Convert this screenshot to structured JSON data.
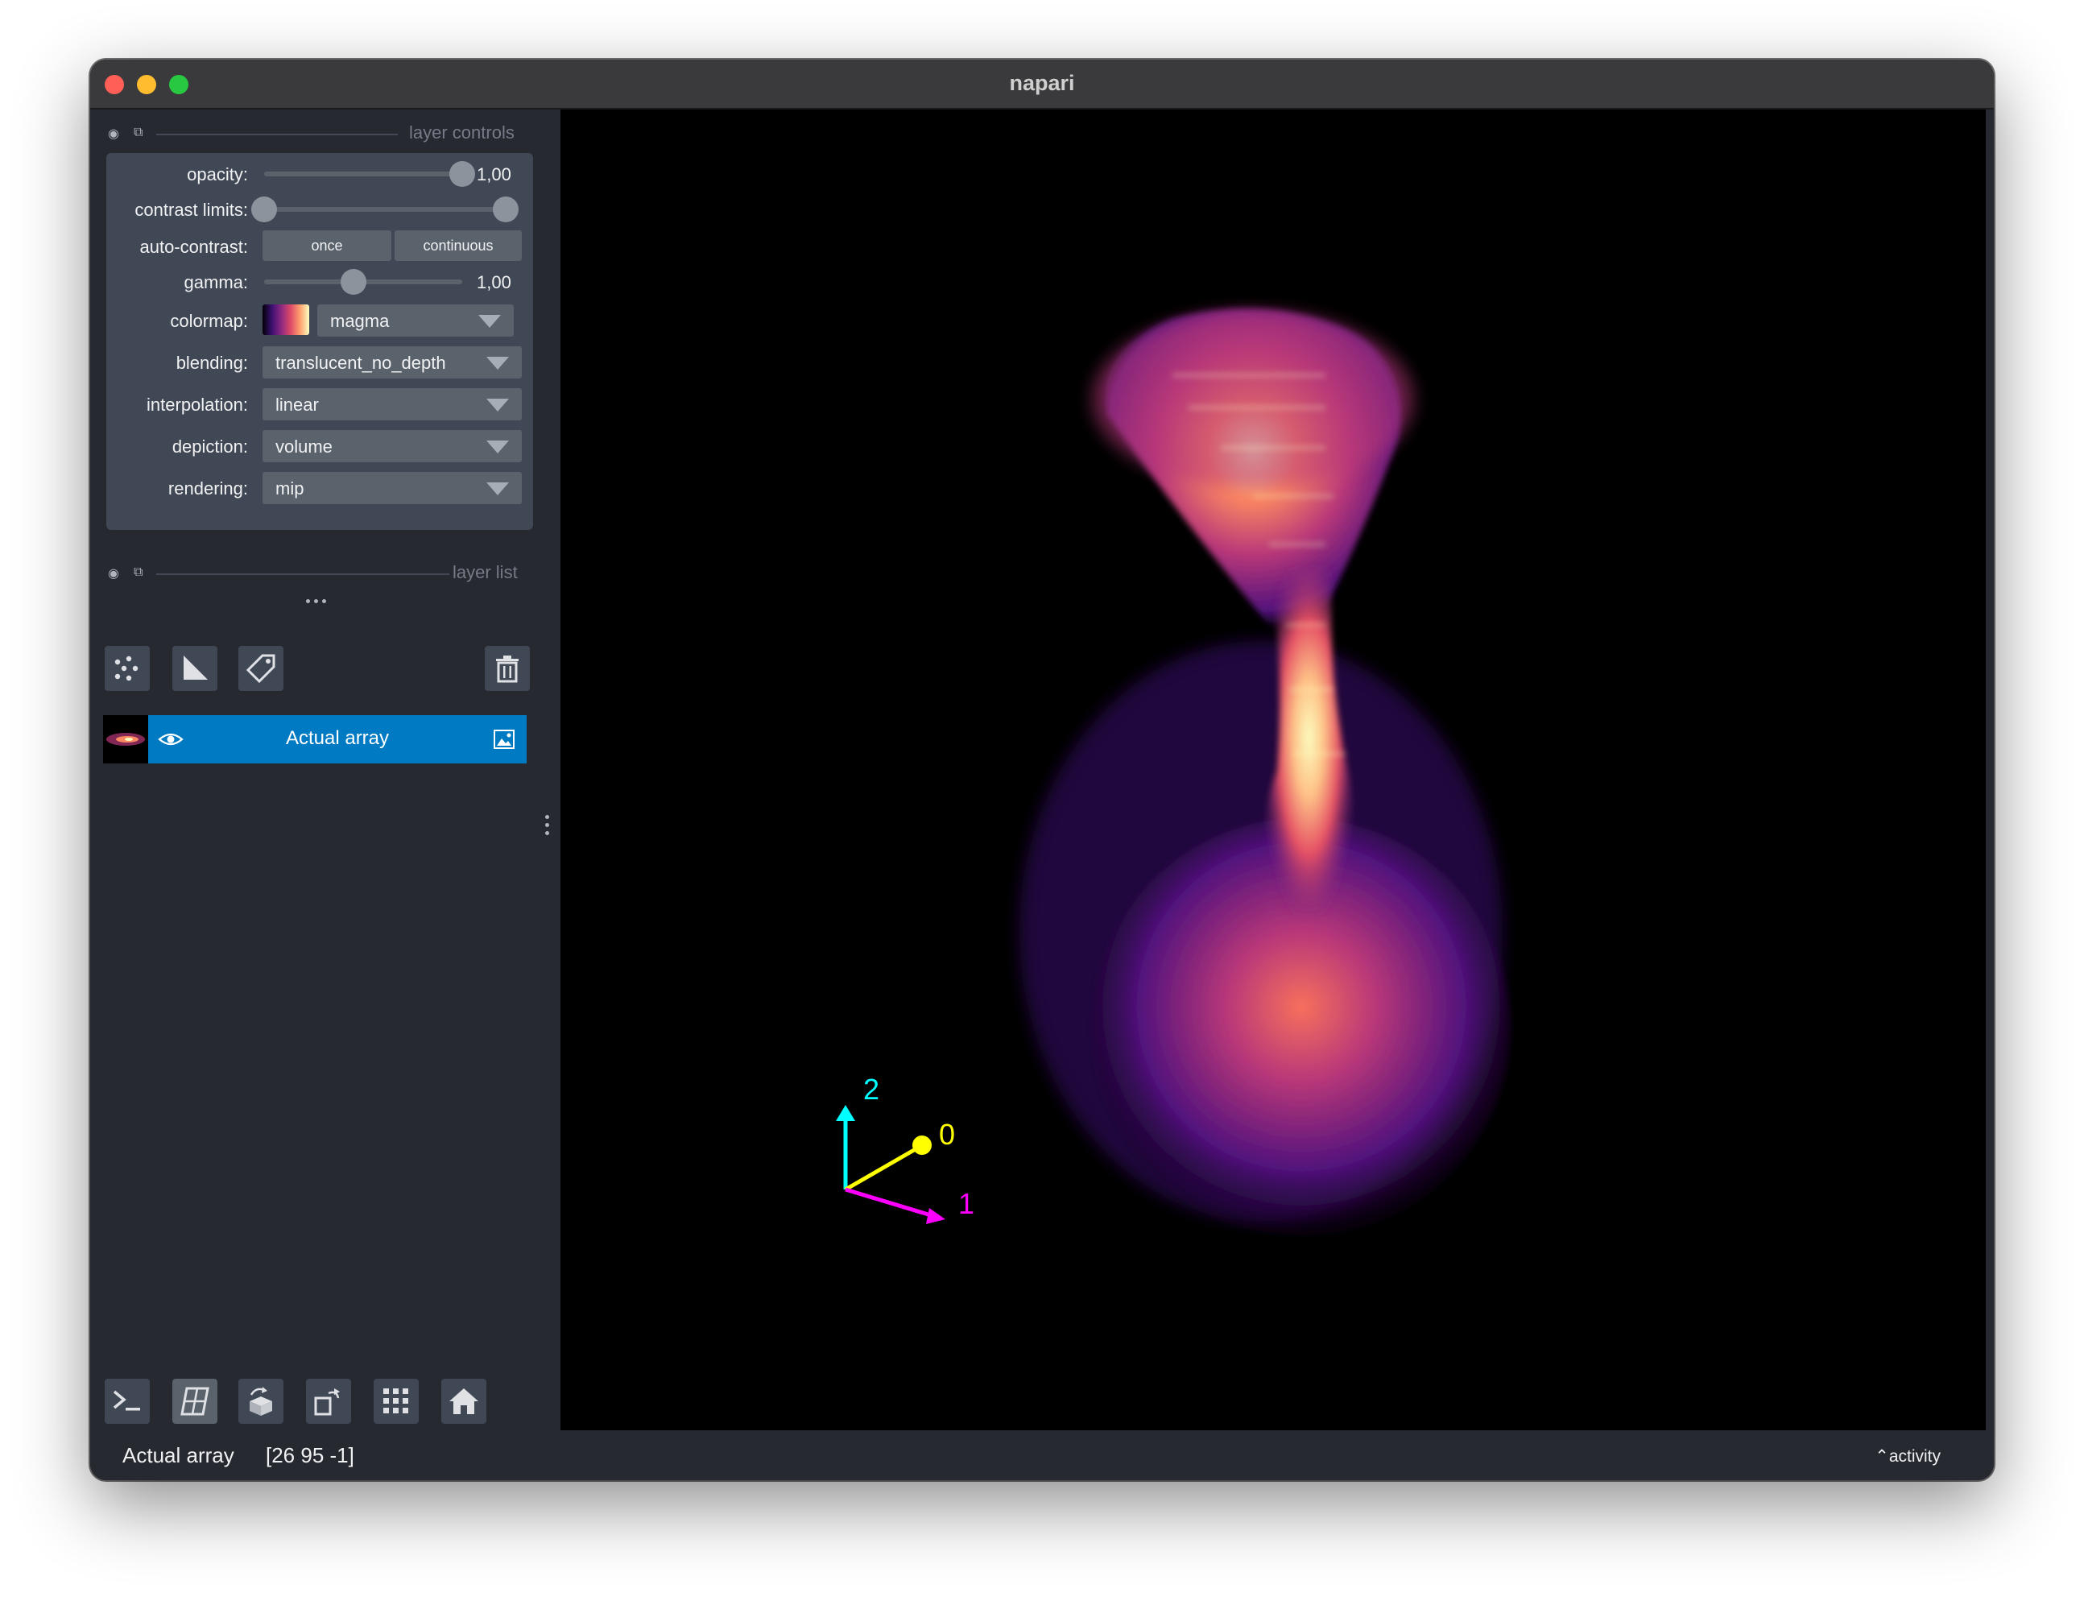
{
  "window": {
    "title": "napari"
  },
  "layer_controls": {
    "header_label": "layer controls",
    "opacity": {
      "label": "opacity:",
      "value": "1,00",
      "level": 1.0
    },
    "contrast_limits": {
      "label": "contrast limits:",
      "low": 0.0,
      "high": 1.0
    },
    "auto_contrast": {
      "label": "auto-contrast:",
      "once_label": "once",
      "continuous_label": "continuous"
    },
    "gamma": {
      "label": "gamma:",
      "value": "1,00",
      "level": 0.45
    },
    "colormap": {
      "label": "colormap:",
      "value": "magma"
    },
    "blending": {
      "label": "blending:",
      "value": "translucent_no_depth"
    },
    "interpolation": {
      "label": "interpolation:",
      "value": "linear"
    },
    "depiction": {
      "label": "depiction:",
      "value": "volume"
    },
    "rendering": {
      "label": "rendering:",
      "value": "mip"
    }
  },
  "layer_list": {
    "header_label": "layer list",
    "tools": [
      "new-points-icon",
      "new-shapes-icon",
      "new-labels-icon",
      "delete-layer-icon"
    ],
    "layers": [
      {
        "name": "Actual array",
        "visible": true,
        "type_icon": "image-icon"
      }
    ]
  },
  "viewer_buttons": [
    "console-icon",
    "ndisplay-3d-icon",
    "roll-dims-icon",
    "transpose-dims-icon",
    "grid-icon",
    "home-icon"
  ],
  "canvas": {
    "axes": {
      "axis_0": "0",
      "axis_1": "1",
      "axis_2": "2"
    },
    "colors": {
      "axis_0": "#ffff00",
      "axis_1": "#ff00ff",
      "axis_2": "#00ffff"
    }
  },
  "status": {
    "layer_name": "Actual array",
    "coords": "[26 95 -1]",
    "activity_label": "activity"
  }
}
